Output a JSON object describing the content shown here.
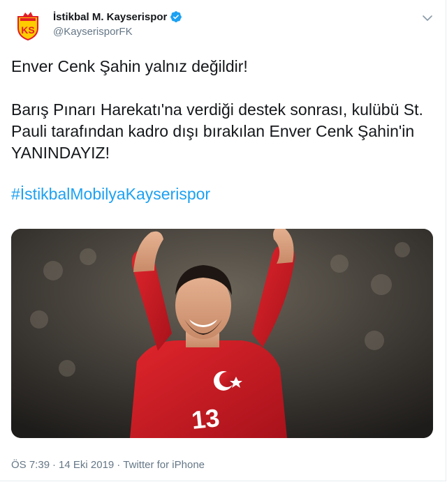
{
  "account": {
    "display_name": "İstikbal M. Kayserispor",
    "handle": "@KayserisporFK",
    "verified_icon": "verified-badge-icon",
    "avatar_letters": "KS"
  },
  "tweet": {
    "line1": "Enver Cenk Şahin yalnız değildir!",
    "line2": "Barış Pınarı Harekatı'na verdiği destek sonrası, kulübü St. Pauli tarafından kadro dışı bırakılan Enver Cenk Şahin'in YANINDAYIZ!",
    "hashtag": "#İstikbalMobilyaKayserispor"
  },
  "media": {
    "jersey_number": "13"
  },
  "meta": {
    "time": "ÖS 7:39",
    "separator1": "·",
    "date": "14 Eki 2019",
    "separator2": "·",
    "source": "Twitter for iPhone"
  },
  "colors": {
    "link": "#1da1f2",
    "secondary_text": "#657786",
    "primary_text": "#14171a",
    "brand_red": "#e21e26",
    "brand_yellow": "#ffcc00"
  }
}
